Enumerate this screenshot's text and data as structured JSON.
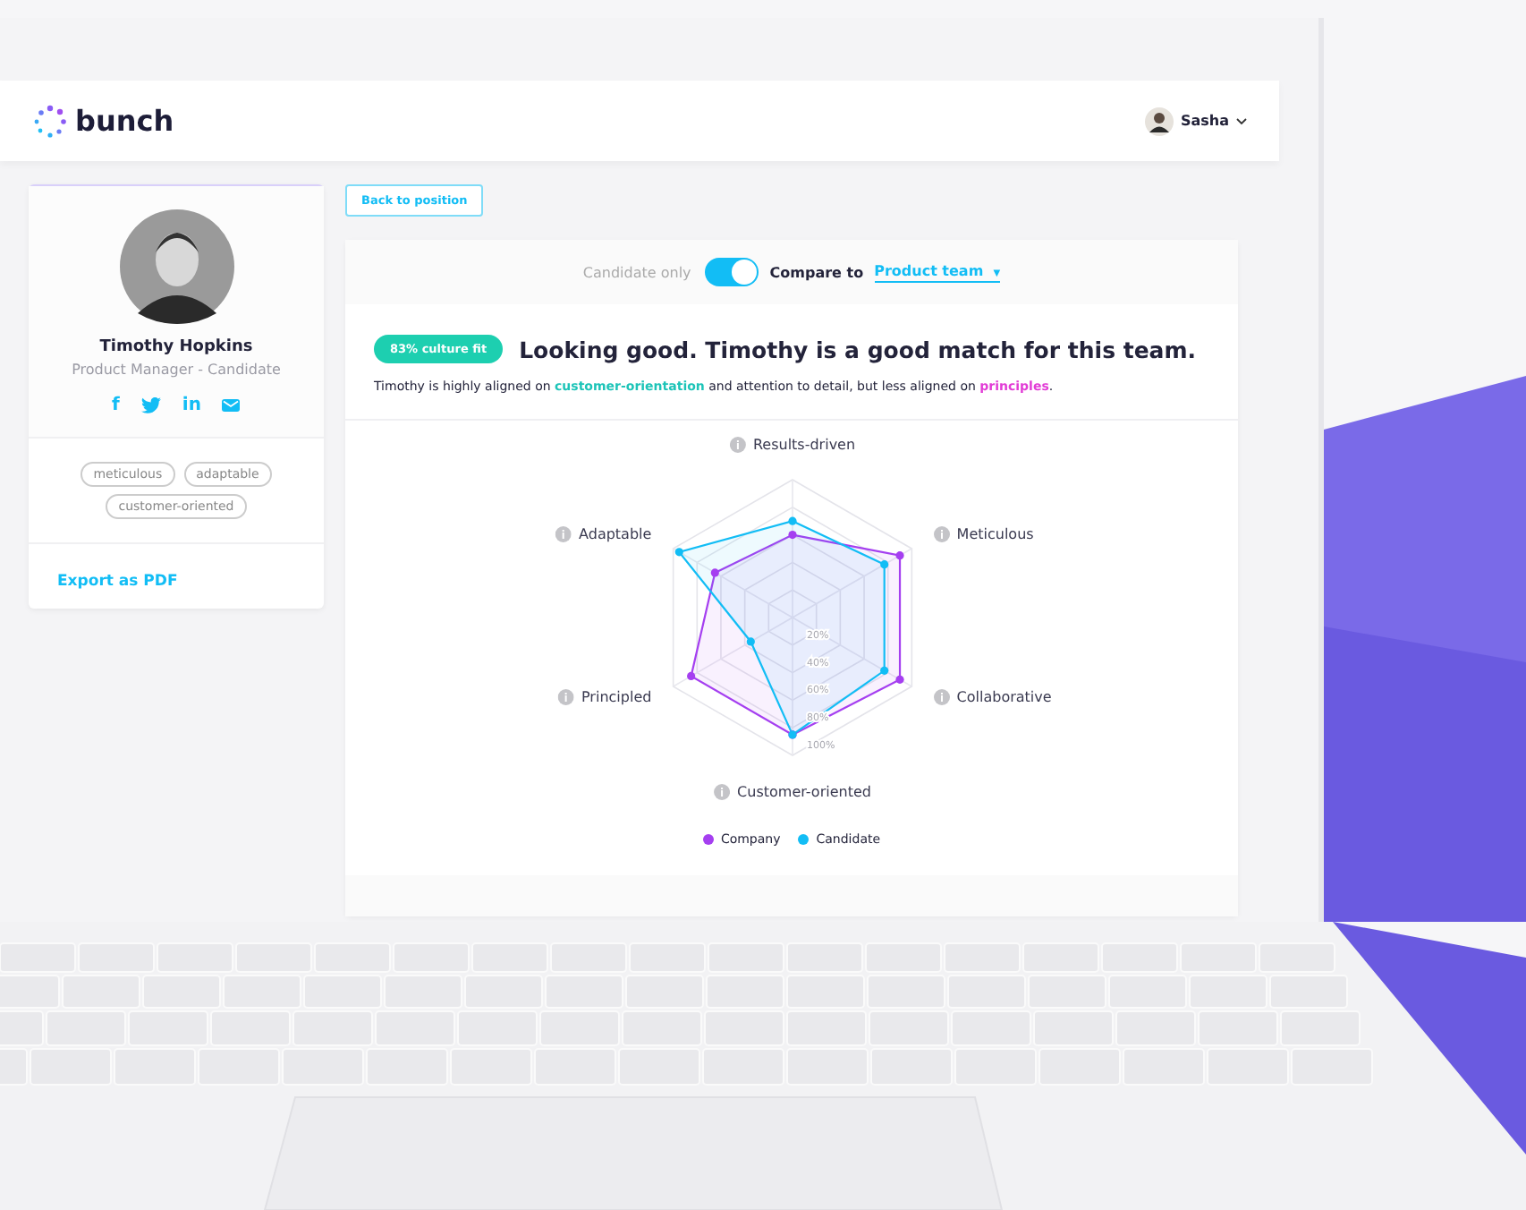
{
  "header": {
    "logo": "bunch",
    "user": {
      "name": "Sasha"
    }
  },
  "profile": {
    "name": "Timothy Hopkins",
    "role": "Product Manager - Candidate",
    "social": [
      {
        "kind": "facebook",
        "label": "f"
      },
      {
        "kind": "twitter"
      },
      {
        "kind": "linkedin",
        "label": "in"
      },
      {
        "kind": "email"
      }
    ],
    "tags": [
      "meticulous",
      "adaptable",
      "customer-oriented"
    ],
    "export": "Export as PDF"
  },
  "back_button": "Back to position",
  "compare": {
    "left_label": "Candidate only",
    "toggle_on": true,
    "compare_label": "Compare to",
    "team": "Product team",
    "caret": "▼"
  },
  "summary": {
    "badge": "83% culture fit",
    "headline": "Looking good. Timothy is a good match for this team.",
    "text": [
      {
        "kind": "plain",
        "text": "Timothy is highly aligned on "
      },
      {
        "kind": "positive",
        "text": "customer-orientation"
      },
      {
        "kind": "plain",
        "text": " and attention to detail, but less aligned  on "
      },
      {
        "kind": "negative",
        "text": "principles"
      },
      {
        "kind": "plain",
        "text": "."
      }
    ]
  },
  "chart_data": {
    "type": "radar",
    "categories": [
      "Results-driven",
      "Meticulous",
      "Collaborative",
      "Customer-oriented",
      "Principled",
      "Adaptable"
    ],
    "yticks": [
      {
        "value": 20,
        "label": "20%"
      },
      {
        "value": 40,
        "label": "40%"
      },
      {
        "value": 60,
        "label": "60%"
      },
      {
        "value": 80,
        "label": "80%"
      },
      {
        "value": 100,
        "label": "100%"
      }
    ],
    "ylim": [
      0,
      100
    ],
    "legend": "bottom",
    "series": [
      {
        "name": "Company",
        "color": "#a53ff0",
        "values": [
          60,
          90,
          90,
          85,
          85,
          65
        ]
      },
      {
        "name": "Candidate",
        "color": "#12bdf5",
        "values": [
          70,
          77,
          77,
          85,
          35,
          95
        ]
      }
    ]
  }
}
